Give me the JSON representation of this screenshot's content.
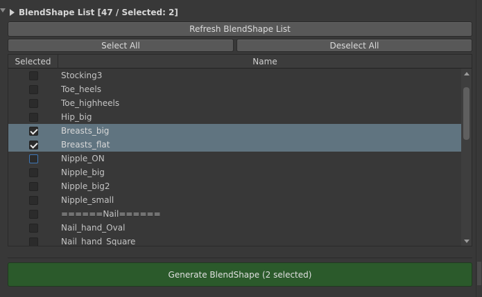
{
  "foldout": {
    "label": "BlendShape List [47 / Selected: 2]"
  },
  "buttons": {
    "refresh": "Refresh BlendShape List",
    "select_all": "Select All",
    "deselect_all": "Deselect All",
    "generate": "Generate BlendShape (2 selected)"
  },
  "table": {
    "headers": {
      "selected": "Selected",
      "name": "Name"
    },
    "rows": [
      {
        "name": "Stocking3",
        "checked": false,
        "highlighted": false,
        "focused": false
      },
      {
        "name": "Toe_heels",
        "checked": false,
        "highlighted": false,
        "focused": false
      },
      {
        "name": "Toe_highheels",
        "checked": false,
        "highlighted": false,
        "focused": false
      },
      {
        "name": "Hip_big",
        "checked": false,
        "highlighted": false,
        "focused": false
      },
      {
        "name": "Breasts_big",
        "checked": true,
        "highlighted": true,
        "focused": false
      },
      {
        "name": "Breasts_flat",
        "checked": true,
        "highlighted": true,
        "focused": false
      },
      {
        "name": "Nipple_ON",
        "checked": false,
        "highlighted": false,
        "focused": true
      },
      {
        "name": "Nipple_big",
        "checked": false,
        "highlighted": false,
        "focused": false
      },
      {
        "name": "Nipple_big2",
        "checked": false,
        "highlighted": false,
        "focused": false
      },
      {
        "name": "Nipple_small",
        "checked": false,
        "highlighted": false,
        "focused": false
      },
      {
        "name": "======Nail======",
        "checked": false,
        "highlighted": false,
        "focused": false
      },
      {
        "name": "Nail_hand_Oval",
        "checked": false,
        "highlighted": false,
        "focused": false
      },
      {
        "name": "Nail_hand_Square",
        "checked": false,
        "highlighted": false,
        "focused": false
      }
    ]
  },
  "colors": {
    "background": "#383838",
    "row_highlight": "#607480",
    "generate_button": "#2b5a2b",
    "checkbox_focus": "#3e78b8"
  }
}
